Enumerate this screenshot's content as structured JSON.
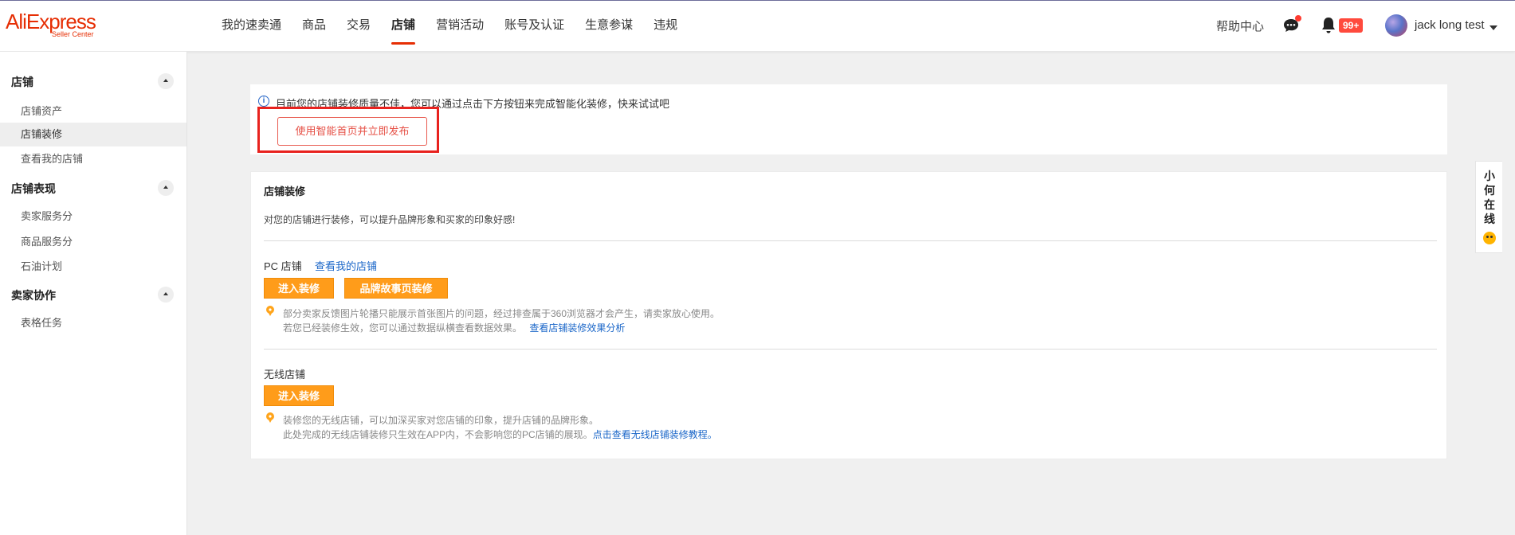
{
  "header": {
    "logo_brand": "AliExpress",
    "logo_sub": "Seller Center",
    "nav": [
      "我的速卖通",
      "商品",
      "交易",
      "店铺",
      "营销活动",
      "账号及认证",
      "生意参谋",
      "违规"
    ],
    "active_nav": "店铺",
    "help": "帮助中心",
    "notification_badge": "99+",
    "user_name": "jack long test"
  },
  "sidebar": {
    "groups": [
      {
        "title": "店铺",
        "items": [
          "店铺资产",
          "店铺装修",
          "查看我的店铺"
        ]
      },
      {
        "title": "店铺表现",
        "items": [
          "卖家服务分",
          "商品服务分",
          "石油计划"
        ]
      },
      {
        "title": "卖家协作",
        "items": [
          "表格任务"
        ]
      }
    ],
    "active_item": "店铺装修"
  },
  "notice": {
    "text": "目前您的店铺装修质量不佳，您可以通过点击下方按钮来完成智能化装修，快来试试吧",
    "button": "使用智能首页并立即发布"
  },
  "panel": {
    "title": "店铺装修",
    "description": "对您的店铺进行装修，可以提升品牌形象和买家的印象好感!",
    "pc": {
      "label": "PC 店铺",
      "link": "查看我的店铺",
      "buttons": [
        "进入装修",
        "品牌故事页装修"
      ],
      "tip_line1": "部分卖家反馈图片轮播只能展示首张图片的问题，经过排查属于360浏览器才会产生，请卖家放心使用。",
      "tip_line2": "若您已经装修生效，您可以通过数据纵横查看数据效果。",
      "tip_link": "查看店铺装修效果分析"
    },
    "wireless": {
      "label": "无线店铺",
      "button": "进入装修",
      "tip_line1": "装修您的无线店铺，可以加深买家对您店铺的印象，提升店铺的品牌形象。",
      "tip_line2": "此处完成的无线店铺装修只生效在APP内，不会影响您的PC店铺的展现。",
      "tip_link": "点击查看无线店铺装修教程。"
    }
  },
  "float_widget": {
    "chars": [
      "小",
      "何",
      "在",
      "线"
    ]
  },
  "colors": {
    "brand": "#e62e04",
    "orange_button": "#ff9c1a",
    "link": "#1a66c8",
    "highlight_frame": "#e8221e"
  }
}
